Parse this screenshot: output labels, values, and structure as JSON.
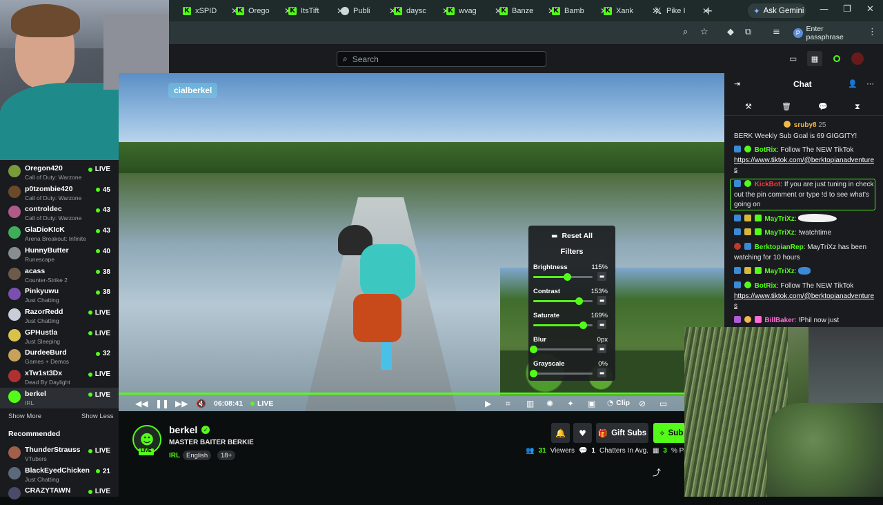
{
  "browser": {
    "tabs": [
      {
        "label": "xSPID",
        "icon": "kick"
      },
      {
        "label": "Orego",
        "icon": "kick"
      },
      {
        "label": "ItsTift",
        "icon": "kick"
      },
      {
        "label": "Publi",
        "icon": "globe"
      },
      {
        "label": "daysc",
        "icon": "kick"
      },
      {
        "label": "wvag",
        "icon": "kick"
      },
      {
        "label": "Banze",
        "icon": "kick"
      },
      {
        "label": "Bamb",
        "icon": "kick"
      },
      {
        "label": "Xank",
        "icon": "kick"
      },
      {
        "label": "Pike I",
        "icon": "x"
      }
    ],
    "new_tab": "+",
    "gemini_label": "Ask Gemini",
    "passphrase_label": "Enter passphrase",
    "profile_initial": "P"
  },
  "kick_nav": {
    "search_placeholder": "Search"
  },
  "sidebar": {
    "channels": [
      {
        "name": "Oregon420",
        "game": "Call of Duty: Warzone",
        "status": "LIVE",
        "color": "#7a9b3a"
      },
      {
        "name": "p0tzombie420",
        "game": "Call of Duty: Warzone",
        "status": "45",
        "color": "#6b4a2a"
      },
      {
        "name": "controldec",
        "game": "Call of Duty: Warzone",
        "status": "43",
        "color": "#b05a8a"
      },
      {
        "name": "GlaDioKIcK",
        "game": "Arena Breakout: Infinite",
        "status": "43",
        "color": "#3fae5a"
      },
      {
        "name": "HunnyButter",
        "game": "Runescape",
        "status": "40",
        "color": "#888d91"
      },
      {
        "name": "acass",
        "game": "Counter-Strike 2",
        "status": "38",
        "color": "#6e5a4a"
      },
      {
        "name": "Pinkyuwu",
        "game": "Just Chatting",
        "status": "38",
        "color": "#7b4fb0"
      },
      {
        "name": "RazorRedd",
        "game": "Just Chatting",
        "status": "LIVE",
        "color": "#c9cdd8"
      },
      {
        "name": "GPHustla",
        "game": "Just Sleeping",
        "status": "LIVE",
        "color": "#d8c24a"
      },
      {
        "name": "DurdeeBurd",
        "game": "Games + Demos",
        "status": "32",
        "color": "#c7a25a"
      },
      {
        "name": "xTw1st3Dx",
        "game": "Dead By Daylight",
        "status": "LIVE",
        "color": "#b03030"
      },
      {
        "name": "berkel",
        "game": "IRL",
        "status": "LIVE",
        "color": "#53fc18"
      }
    ],
    "show_more": "Show More",
    "show_less": "Show Less",
    "recommended_heading": "Recommended",
    "recommended": [
      {
        "name": "ThunderStrauss",
        "game": "VTubers",
        "status": "LIVE",
        "color": "#a0604a"
      },
      {
        "name": "BlackEyedChicken",
        "game": "Just Chatting",
        "status": "21",
        "color": "#5a6a7a"
      },
      {
        "name": "CRAZYTAWN",
        "game": "",
        "status": "LIVE",
        "color": "#4a4a6a"
      }
    ]
  },
  "video": {
    "watermark": "cialberkel",
    "time": "06:08:41",
    "live_label": "LIVE",
    "clip_label": "Clip",
    "progress": 0.97,
    "filters": {
      "reset_label": "Reset All",
      "title": "Filters",
      "items": [
        {
          "label": "Brightness",
          "value": "115%",
          "level": 0.57
        },
        {
          "label": "Contrast",
          "value": "153%",
          "level": 0.77
        },
        {
          "label": "Saturate",
          "value": "169%",
          "level": 0.84
        },
        {
          "label": "Blur",
          "value": "0px",
          "level": 0.0
        },
        {
          "label": "Grayscale",
          "value": "0%",
          "level": 0.0
        }
      ]
    }
  },
  "channel": {
    "name": "berkel",
    "live_badge": "LIVE",
    "title": "MASTER BAITER BERKIE",
    "category": "IRL",
    "tags": [
      "English",
      "18+"
    ],
    "gift_subs": "Gift Subs",
    "subscribe": "Sub",
    "viewers": "31",
    "viewers_label": "Viewers",
    "chatters": "1",
    "chatters_label": "Chatters In Avg.",
    "part_value": "3",
    "part_label": "% Part"
  },
  "chat": {
    "title": "Chat",
    "messages": [
      {
        "user": "sruby8",
        "text": "25",
        "color": "#f2b84b"
      },
      {
        "user": "",
        "text": "BERK Weekly Sub Goal is 69 GIGGITY!",
        "color": "#fff"
      },
      {
        "user": "BotRix",
        "text": "Follow The NEW TikTok",
        "link": "https://www.tiktok.com/@berktopianadventures",
        "color": "#53fc18"
      },
      {
        "user": "KickBot",
        "text": "If you are just tuning in check out the pin comment or type !d to see what's going on",
        "color": "#ff3a3a"
      },
      {
        "user": "MayTriXz",
        "text": "",
        "color": "#53fc18"
      },
      {
        "user": "MayTriXz",
        "text": "!watchtime",
        "color": "#53fc18"
      },
      {
        "user": "BerktopianRep",
        "text": "MayTriXz has been watching for 10 hours",
        "color": "#53fc18"
      },
      {
        "user": "MayTriXz",
        "text": "",
        "color": "#53fc18"
      },
      {
        "user": "BotRix",
        "text": "Follow The NEW TikTok",
        "link": "https://www.tiktok.com/@berktopianadventures",
        "color": "#53fc18"
      },
      {
        "user": "BillBaker",
        "text": "!Phil now just",
        "color": "#ff6ad5"
      }
    ]
  },
  "colors": {
    "accent": "#53fc18",
    "panel": "#191b1f",
    "background": "#0b0e0f"
  }
}
